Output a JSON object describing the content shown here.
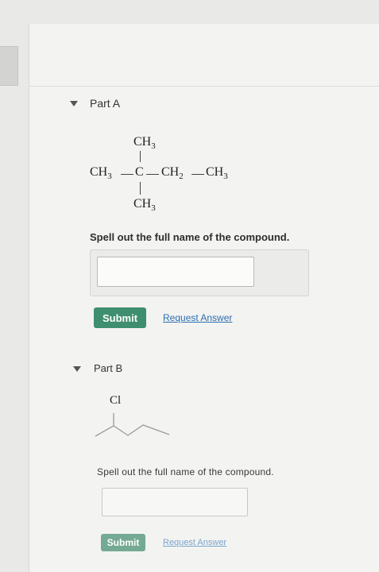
{
  "partA": {
    "title": "Part A",
    "formula": {
      "top": "CH3",
      "left": "CH3",
      "center": "C",
      "right1": "CH2",
      "right2": "CH3",
      "bottom": "CH3"
    },
    "prompt": "Spell out the full name of the compound.",
    "answer_value": "",
    "submit_label": "Submit",
    "request_label": "Request Answer"
  },
  "partB": {
    "title": "Part B",
    "substituent": "Cl",
    "prompt": "Spell out the full name of the compound.",
    "answer_value": "",
    "submit_label": "Submit",
    "request_label": "Request Answer"
  }
}
